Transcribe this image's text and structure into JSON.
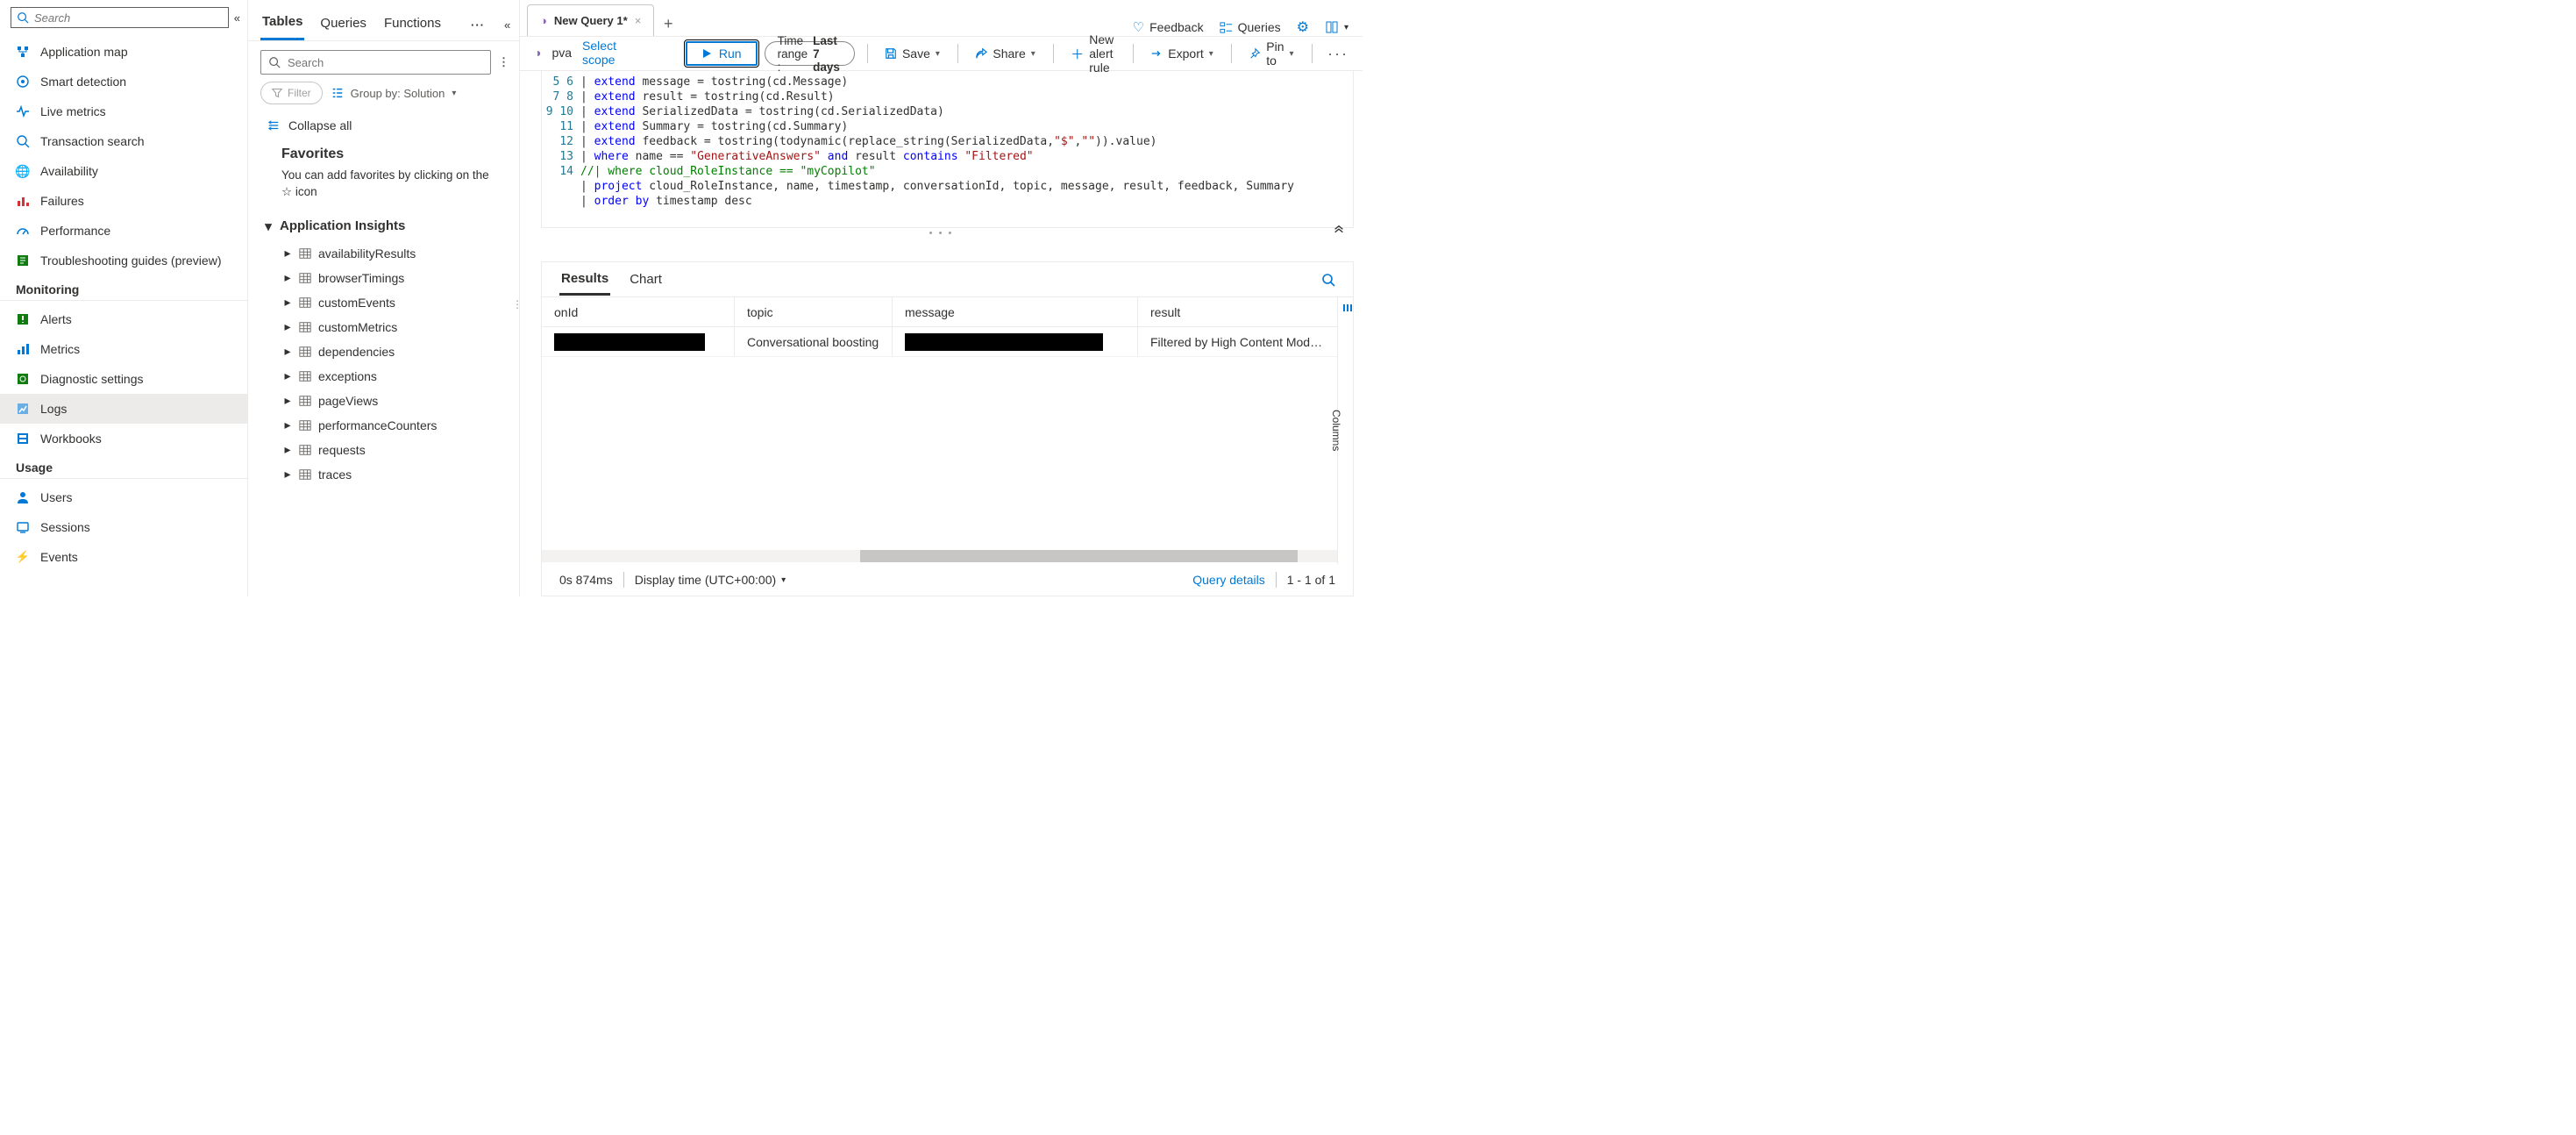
{
  "sidebar": {
    "search_placeholder": "Search",
    "groups": [
      {
        "items": [
          {
            "label": "Application map",
            "icon": "map"
          },
          {
            "label": "Smart detection",
            "icon": "smart"
          },
          {
            "label": "Live metrics",
            "icon": "pulse"
          },
          {
            "label": "Transaction search",
            "icon": "search"
          },
          {
            "label": "Availability",
            "icon": "globe"
          },
          {
            "label": "Failures",
            "icon": "failures"
          },
          {
            "label": "Performance",
            "icon": "gauge"
          },
          {
            "label": "Troubleshooting guides (preview)",
            "icon": "book"
          }
        ]
      },
      {
        "header": "Monitoring",
        "items": [
          {
            "label": "Alerts",
            "icon": "alert"
          },
          {
            "label": "Metrics",
            "icon": "metrics"
          },
          {
            "label": "Diagnostic settings",
            "icon": "diag"
          },
          {
            "label": "Logs",
            "icon": "logs",
            "active": true
          },
          {
            "label": "Workbooks",
            "icon": "workbook"
          }
        ]
      },
      {
        "header": "Usage",
        "items": [
          {
            "label": "Users",
            "icon": "user"
          },
          {
            "label": "Sessions",
            "icon": "sessions"
          },
          {
            "label": "Events",
            "icon": "events"
          }
        ]
      }
    ]
  },
  "schema": {
    "tabs": [
      "Tables",
      "Queries",
      "Functions"
    ],
    "active_tab": "Tables",
    "search_placeholder": "Search",
    "filter_label": "Filter",
    "groupby_label": "Group by: Solution",
    "collapse_all": "Collapse all",
    "favorites_header": "Favorites",
    "favorites_note": "You can add favorites by clicking on the ☆ icon",
    "group_name": "Application Insights",
    "tables": [
      "availabilityResults",
      "browserTimings",
      "customEvents",
      "customMetrics",
      "dependencies",
      "exceptions",
      "pageViews",
      "performanceCounters",
      "requests",
      "traces"
    ]
  },
  "querytab": {
    "title": "New Query 1*",
    "top_actions": {
      "feedback": "Feedback",
      "queries": "Queries"
    },
    "scope_name": "pva",
    "select_scope": "Select scope",
    "toolbar": {
      "run": "Run",
      "time_label": "Time range :",
      "time_value": "Last 7 days",
      "save": "Save",
      "share": "Share",
      "alert": "New alert rule",
      "export": "Export",
      "pin": "Pin to"
    }
  },
  "editor": {
    "first_line_no": 5,
    "lines": [
      {
        "n": 5,
        "html": "| <kw>extend</kw> message = tostring(cd.Message)"
      },
      {
        "n": 6,
        "html": "| <kw>extend</kw> result = tostring(cd.Result)"
      },
      {
        "n": 7,
        "html": "| <kw>extend</kw> SerializedData = tostring(cd.SerializedData)"
      },
      {
        "n": 8,
        "html": "| <kw>extend</kw> Summary = tostring(cd.Summary)"
      },
      {
        "n": 9,
        "html": "| <kw>extend</kw> feedback = tostring(todynamic(replace_string(SerializedData,<str>\"$\"</str>,<str>\"\"</str>)).value)"
      },
      {
        "n": 10,
        "html": "| <kw>where</kw> name == <str>\"GenerativeAnswers\"</str> <kw>and</kw> result <kw>contains</kw> <str>\"Filtered\"</str>"
      },
      {
        "n": 11,
        "html": "<cm>//| where cloud_RoleInstance == \"myCopilot\"</cm>"
      },
      {
        "n": 12,
        "html": "| <kw>project</kw> cloud_RoleInstance, name, timestamp, conversationId, topic, message, result, feedback, Summary"
      },
      {
        "n": 13,
        "html": "| <kw>order</kw> <kw>by</kw> timestamp desc"
      },
      {
        "n": 14,
        "html": ""
      }
    ]
  },
  "results": {
    "tabs": [
      "Results",
      "Chart"
    ],
    "active": "Results",
    "columns_label": "Columns",
    "headers": [
      "onId",
      "topic",
      "message",
      "result"
    ],
    "row": {
      "topic": "Conversational boosting",
      "result": "Filtered by High Content Mod…"
    },
    "status_time": "0s 874ms",
    "display_time": "Display time (UTC+00:00)",
    "query_details": "Query details",
    "paging": "1 - 1 of 1"
  }
}
